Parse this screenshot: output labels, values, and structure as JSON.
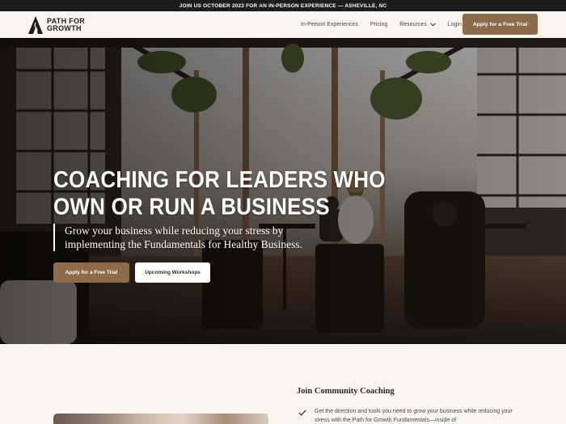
{
  "announcement": "JOIN US OCTOBER 2023 FOR AN IN-PERSON EXPERIENCE — ASHEVILLE, NC",
  "brand": {
    "name": "PATH FOR\nGROWTH",
    "logo_icon": "mountain-path-icon"
  },
  "nav": {
    "links": [
      {
        "label": "In-Person Experiences"
      },
      {
        "label": "Pricing"
      },
      {
        "label": "Resources",
        "icon": "chevron-down-icon"
      },
      {
        "label": "Login"
      }
    ],
    "cta": "Apply for a Free Trial"
  },
  "hero": {
    "title": "COACHING FOR LEADERS WHO OWN OR RUN A BUSINESS",
    "subtitle": "Grow your business while reducing your stress by implementing the Fundamentals for Healthy Business.",
    "primary_button": "Apply for a Free Trial",
    "secondary_button": "Upcoming Workshops"
  },
  "community": {
    "heading": "Join Community Coaching",
    "feature_icon": "checkmark-icon",
    "feature_text": "Get the direction and tools you need to grow your business while reducing your stress with the Path for Growth Fundamentals—inside of"
  },
  "colors": {
    "accent": "#8c6a4a",
    "background": "#f8f5ee",
    "announcement_bar": "#1c1c1c"
  }
}
